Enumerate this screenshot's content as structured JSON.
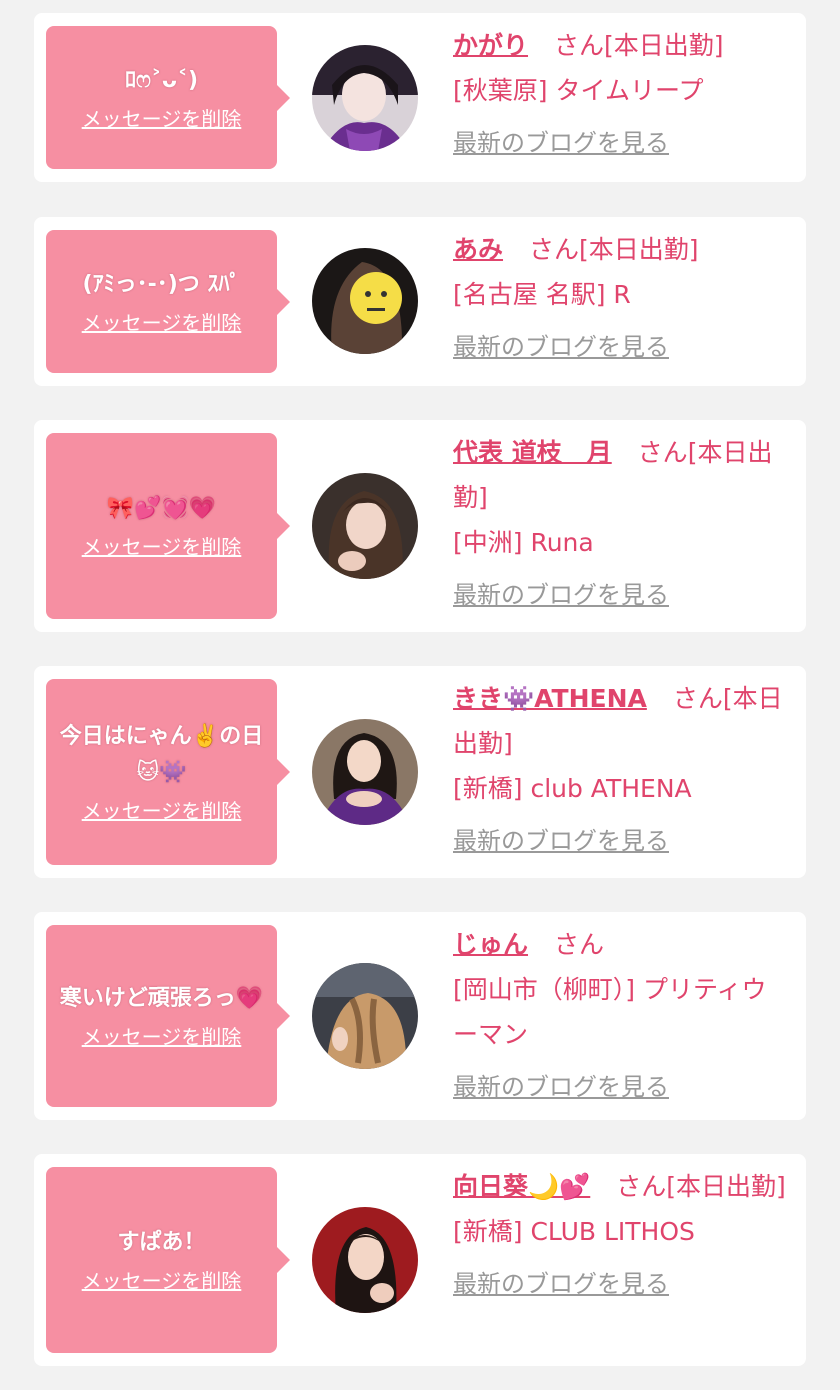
{
  "delete_label": "メッセージを削除",
  "blog_label": "最新のブログを見る",
  "honorific": "さん",
  "cards": [
    {
      "message": "ﾛෆ˃ᴗ˂)",
      "name": "かがり",
      "suffix": "[本日出勤]",
      "shop": "[秋葉原] タイムリープ",
      "avatar_icon": "girl-photo-purple-kimono"
    },
    {
      "message": "(ｱﾐっ･-･)つ ｽﾊﾟ",
      "name": "あみ",
      "suffix": "[本日出勤]",
      "shop": "[名古屋 名駅] R",
      "avatar_icon": "girl-photo-emoji-face"
    },
    {
      "message": "🎀💕💓💗",
      "name": "代表 道枝　月",
      "suffix": "[本日出勤]",
      "shop": "[中洲] Runa",
      "avatar_icon": "girl-photo-long-hair"
    },
    {
      "message": "今日はにゃん✌️の日🐱👾",
      "name": "きき👾ATHENA",
      "suffix": "[本日出勤]",
      "shop": "[新橋] club ATHENA",
      "avatar_icon": "girl-photo-purple-dress"
    },
    {
      "message": "寒いけど頑張ろっ💗",
      "name": "じゅん",
      "suffix": "",
      "shop": "[岡山市（柳町）] プリティウーマン",
      "avatar_icon": "girl-photo-braided-hair"
    },
    {
      "message": "すぱあ！",
      "name": "向日葵🌙💕",
      "suffix": "[本日出勤]",
      "shop": "[新橋] CLUB LITHOS",
      "avatar_icon": "girl-photo-red-background"
    }
  ],
  "colors": {
    "bubble": "#f68fa2",
    "accent_text": "#e0446c",
    "link_gray": "#999999",
    "page_bg": "#f2f2f2"
  }
}
